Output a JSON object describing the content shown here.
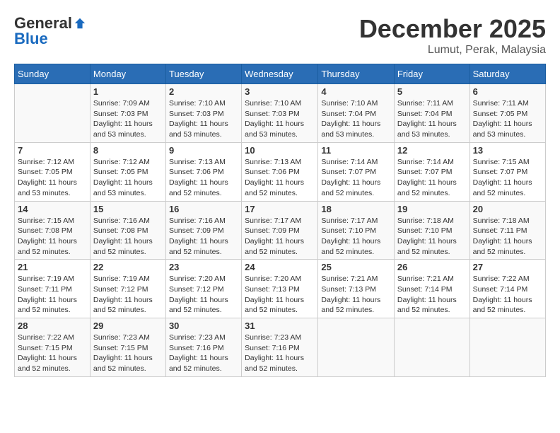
{
  "logo": {
    "general": "General",
    "blue": "Blue"
  },
  "title": "December 2025",
  "location": "Lumut, Perak, Malaysia",
  "days_header": [
    "Sunday",
    "Monday",
    "Tuesday",
    "Wednesday",
    "Thursday",
    "Friday",
    "Saturday"
  ],
  "weeks": [
    [
      {
        "day": "",
        "sunrise": "",
        "sunset": "",
        "daylight": ""
      },
      {
        "day": "1",
        "sunrise": "Sunrise: 7:09 AM",
        "sunset": "Sunset: 7:03 PM",
        "daylight": "Daylight: 11 hours and 53 minutes."
      },
      {
        "day": "2",
        "sunrise": "Sunrise: 7:10 AM",
        "sunset": "Sunset: 7:03 PM",
        "daylight": "Daylight: 11 hours and 53 minutes."
      },
      {
        "day": "3",
        "sunrise": "Sunrise: 7:10 AM",
        "sunset": "Sunset: 7:03 PM",
        "daylight": "Daylight: 11 hours and 53 minutes."
      },
      {
        "day": "4",
        "sunrise": "Sunrise: 7:10 AM",
        "sunset": "Sunset: 7:04 PM",
        "daylight": "Daylight: 11 hours and 53 minutes."
      },
      {
        "day": "5",
        "sunrise": "Sunrise: 7:11 AM",
        "sunset": "Sunset: 7:04 PM",
        "daylight": "Daylight: 11 hours and 53 minutes."
      },
      {
        "day": "6",
        "sunrise": "Sunrise: 7:11 AM",
        "sunset": "Sunset: 7:05 PM",
        "daylight": "Daylight: 11 hours and 53 minutes."
      }
    ],
    [
      {
        "day": "7",
        "sunrise": "Sunrise: 7:12 AM",
        "sunset": "Sunset: 7:05 PM",
        "daylight": "Daylight: 11 hours and 53 minutes."
      },
      {
        "day": "8",
        "sunrise": "Sunrise: 7:12 AM",
        "sunset": "Sunset: 7:05 PM",
        "daylight": "Daylight: 11 hours and 53 minutes."
      },
      {
        "day": "9",
        "sunrise": "Sunrise: 7:13 AM",
        "sunset": "Sunset: 7:06 PM",
        "daylight": "Daylight: 11 hours and 52 minutes."
      },
      {
        "day": "10",
        "sunrise": "Sunrise: 7:13 AM",
        "sunset": "Sunset: 7:06 PM",
        "daylight": "Daylight: 11 hours and 52 minutes."
      },
      {
        "day": "11",
        "sunrise": "Sunrise: 7:14 AM",
        "sunset": "Sunset: 7:07 PM",
        "daylight": "Daylight: 11 hours and 52 minutes."
      },
      {
        "day": "12",
        "sunrise": "Sunrise: 7:14 AM",
        "sunset": "Sunset: 7:07 PM",
        "daylight": "Daylight: 11 hours and 52 minutes."
      },
      {
        "day": "13",
        "sunrise": "Sunrise: 7:15 AM",
        "sunset": "Sunset: 7:07 PM",
        "daylight": "Daylight: 11 hours and 52 minutes."
      }
    ],
    [
      {
        "day": "14",
        "sunrise": "Sunrise: 7:15 AM",
        "sunset": "Sunset: 7:08 PM",
        "daylight": "Daylight: 11 hours and 52 minutes."
      },
      {
        "day": "15",
        "sunrise": "Sunrise: 7:16 AM",
        "sunset": "Sunset: 7:08 PM",
        "daylight": "Daylight: 11 hours and 52 minutes."
      },
      {
        "day": "16",
        "sunrise": "Sunrise: 7:16 AM",
        "sunset": "Sunset: 7:09 PM",
        "daylight": "Daylight: 11 hours and 52 minutes."
      },
      {
        "day": "17",
        "sunrise": "Sunrise: 7:17 AM",
        "sunset": "Sunset: 7:09 PM",
        "daylight": "Daylight: 11 hours and 52 minutes."
      },
      {
        "day": "18",
        "sunrise": "Sunrise: 7:17 AM",
        "sunset": "Sunset: 7:10 PM",
        "daylight": "Daylight: 11 hours and 52 minutes."
      },
      {
        "day": "19",
        "sunrise": "Sunrise: 7:18 AM",
        "sunset": "Sunset: 7:10 PM",
        "daylight": "Daylight: 11 hours and 52 minutes."
      },
      {
        "day": "20",
        "sunrise": "Sunrise: 7:18 AM",
        "sunset": "Sunset: 7:11 PM",
        "daylight": "Daylight: 11 hours and 52 minutes."
      }
    ],
    [
      {
        "day": "21",
        "sunrise": "Sunrise: 7:19 AM",
        "sunset": "Sunset: 7:11 PM",
        "daylight": "Daylight: 11 hours and 52 minutes."
      },
      {
        "day": "22",
        "sunrise": "Sunrise: 7:19 AM",
        "sunset": "Sunset: 7:12 PM",
        "daylight": "Daylight: 11 hours and 52 minutes."
      },
      {
        "day": "23",
        "sunrise": "Sunrise: 7:20 AM",
        "sunset": "Sunset: 7:12 PM",
        "daylight": "Daylight: 11 hours and 52 minutes."
      },
      {
        "day": "24",
        "sunrise": "Sunrise: 7:20 AM",
        "sunset": "Sunset: 7:13 PM",
        "daylight": "Daylight: 11 hours and 52 minutes."
      },
      {
        "day": "25",
        "sunrise": "Sunrise: 7:21 AM",
        "sunset": "Sunset: 7:13 PM",
        "daylight": "Daylight: 11 hours and 52 minutes."
      },
      {
        "day": "26",
        "sunrise": "Sunrise: 7:21 AM",
        "sunset": "Sunset: 7:14 PM",
        "daylight": "Daylight: 11 hours and 52 minutes."
      },
      {
        "day": "27",
        "sunrise": "Sunrise: 7:22 AM",
        "sunset": "Sunset: 7:14 PM",
        "daylight": "Daylight: 11 hours and 52 minutes."
      }
    ],
    [
      {
        "day": "28",
        "sunrise": "Sunrise: 7:22 AM",
        "sunset": "Sunset: 7:15 PM",
        "daylight": "Daylight: 11 hours and 52 minutes."
      },
      {
        "day": "29",
        "sunrise": "Sunrise: 7:23 AM",
        "sunset": "Sunset: 7:15 PM",
        "daylight": "Daylight: 11 hours and 52 minutes."
      },
      {
        "day": "30",
        "sunrise": "Sunrise: 7:23 AM",
        "sunset": "Sunset: 7:16 PM",
        "daylight": "Daylight: 11 hours and 52 minutes."
      },
      {
        "day": "31",
        "sunrise": "Sunrise: 7:23 AM",
        "sunset": "Sunset: 7:16 PM",
        "daylight": "Daylight: 11 hours and 52 minutes."
      },
      {
        "day": "",
        "sunrise": "",
        "sunset": "",
        "daylight": ""
      },
      {
        "day": "",
        "sunrise": "",
        "sunset": "",
        "daylight": ""
      },
      {
        "day": "",
        "sunrise": "",
        "sunset": "",
        "daylight": ""
      }
    ]
  ]
}
